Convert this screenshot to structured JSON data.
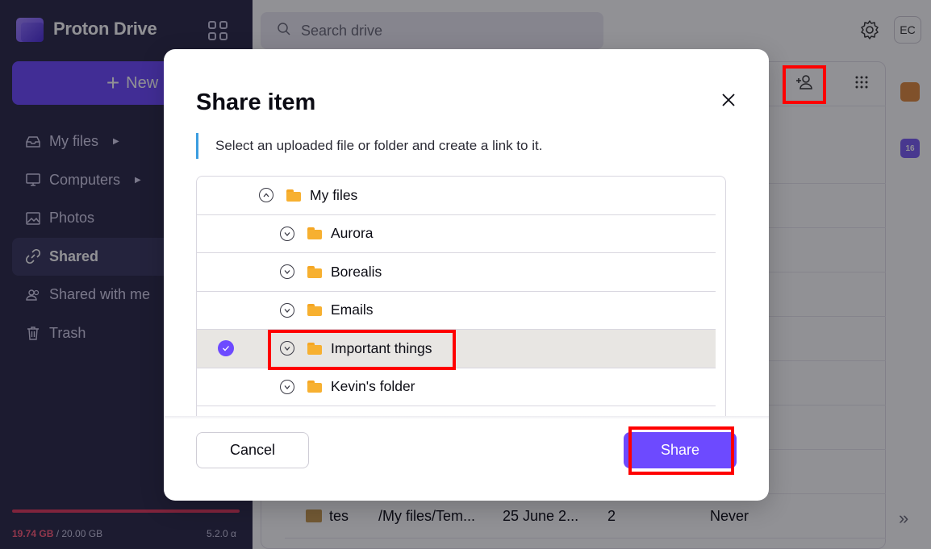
{
  "app": {
    "name": "Proton Drive"
  },
  "sidebar": {
    "new_label": "New",
    "items": [
      {
        "label": "My files",
        "icon": "inbox-icon",
        "has_caret": true
      },
      {
        "label": "Computers",
        "icon": "monitor-icon",
        "has_caret": true
      },
      {
        "label": "Photos",
        "icon": "image-icon",
        "has_caret": false
      },
      {
        "label": "Shared",
        "icon": "link-icon",
        "has_caret": false,
        "active": true
      },
      {
        "label": "Shared with me",
        "icon": "users-icon",
        "has_caret": false
      },
      {
        "label": "Trash",
        "icon": "trash-icon",
        "has_caret": false
      }
    ],
    "storage": {
      "used": "19.74 GB",
      "total": " / 20.00 GB",
      "used_fraction": 0.987
    },
    "version": "5.2.0 α"
  },
  "header": {
    "search_placeholder": "Search drive",
    "avatar_initials": "EC"
  },
  "rail": {
    "calendar_day": "16"
  },
  "background_row": {
    "name": "tes",
    "location": "/My files/Tem...",
    "created": "25 June 2...",
    "count": "2",
    "expires": "Never"
  },
  "modal": {
    "title": "Share item",
    "description": "Select an uploaded file or folder and create a link to it.",
    "tree": {
      "root": "My files",
      "folders": [
        "Aurora",
        "Borealis",
        "Emails",
        "Important things",
        "Kevin's folder"
      ],
      "selected": "Important things"
    },
    "cancel_label": "Cancel",
    "share_label": "Share"
  },
  "colors": {
    "accent": "#6d4aff",
    "sidebar_bg": "#2a2847",
    "folder": "#f7b030",
    "highlight": "#ff0000"
  }
}
